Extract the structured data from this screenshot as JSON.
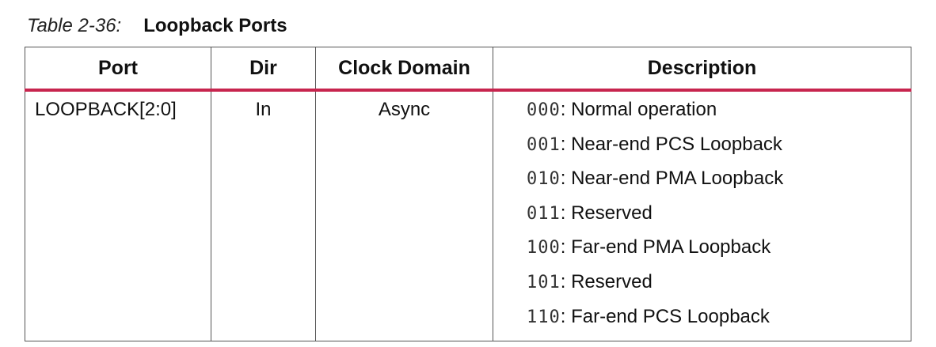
{
  "caption": {
    "number": "Table 2-36:",
    "title": "Loopback Ports"
  },
  "table": {
    "headers": {
      "port": "Port",
      "dir": "Dir",
      "clock_domain": "Clock Domain",
      "description": "Description"
    },
    "header_rule_color": "#c7254e",
    "row": {
      "port": "LOOPBACK[2:0]",
      "dir": "In",
      "clock_domain": "Async",
      "description": [
        {
          "code": "000",
          "text": ": Normal operation"
        },
        {
          "code": "001",
          "text": ": Near-end PCS Loopback"
        },
        {
          "code": "010",
          "text": ": Near-end PMA Loopback"
        },
        {
          "code": "011",
          "text": ": Reserved"
        },
        {
          "code": "100",
          "text": ": Far-end PMA Loopback"
        },
        {
          "code": "101",
          "text": ": Reserved"
        },
        {
          "code": "110",
          "text": ": Far-end PCS Loopback"
        }
      ]
    }
  }
}
